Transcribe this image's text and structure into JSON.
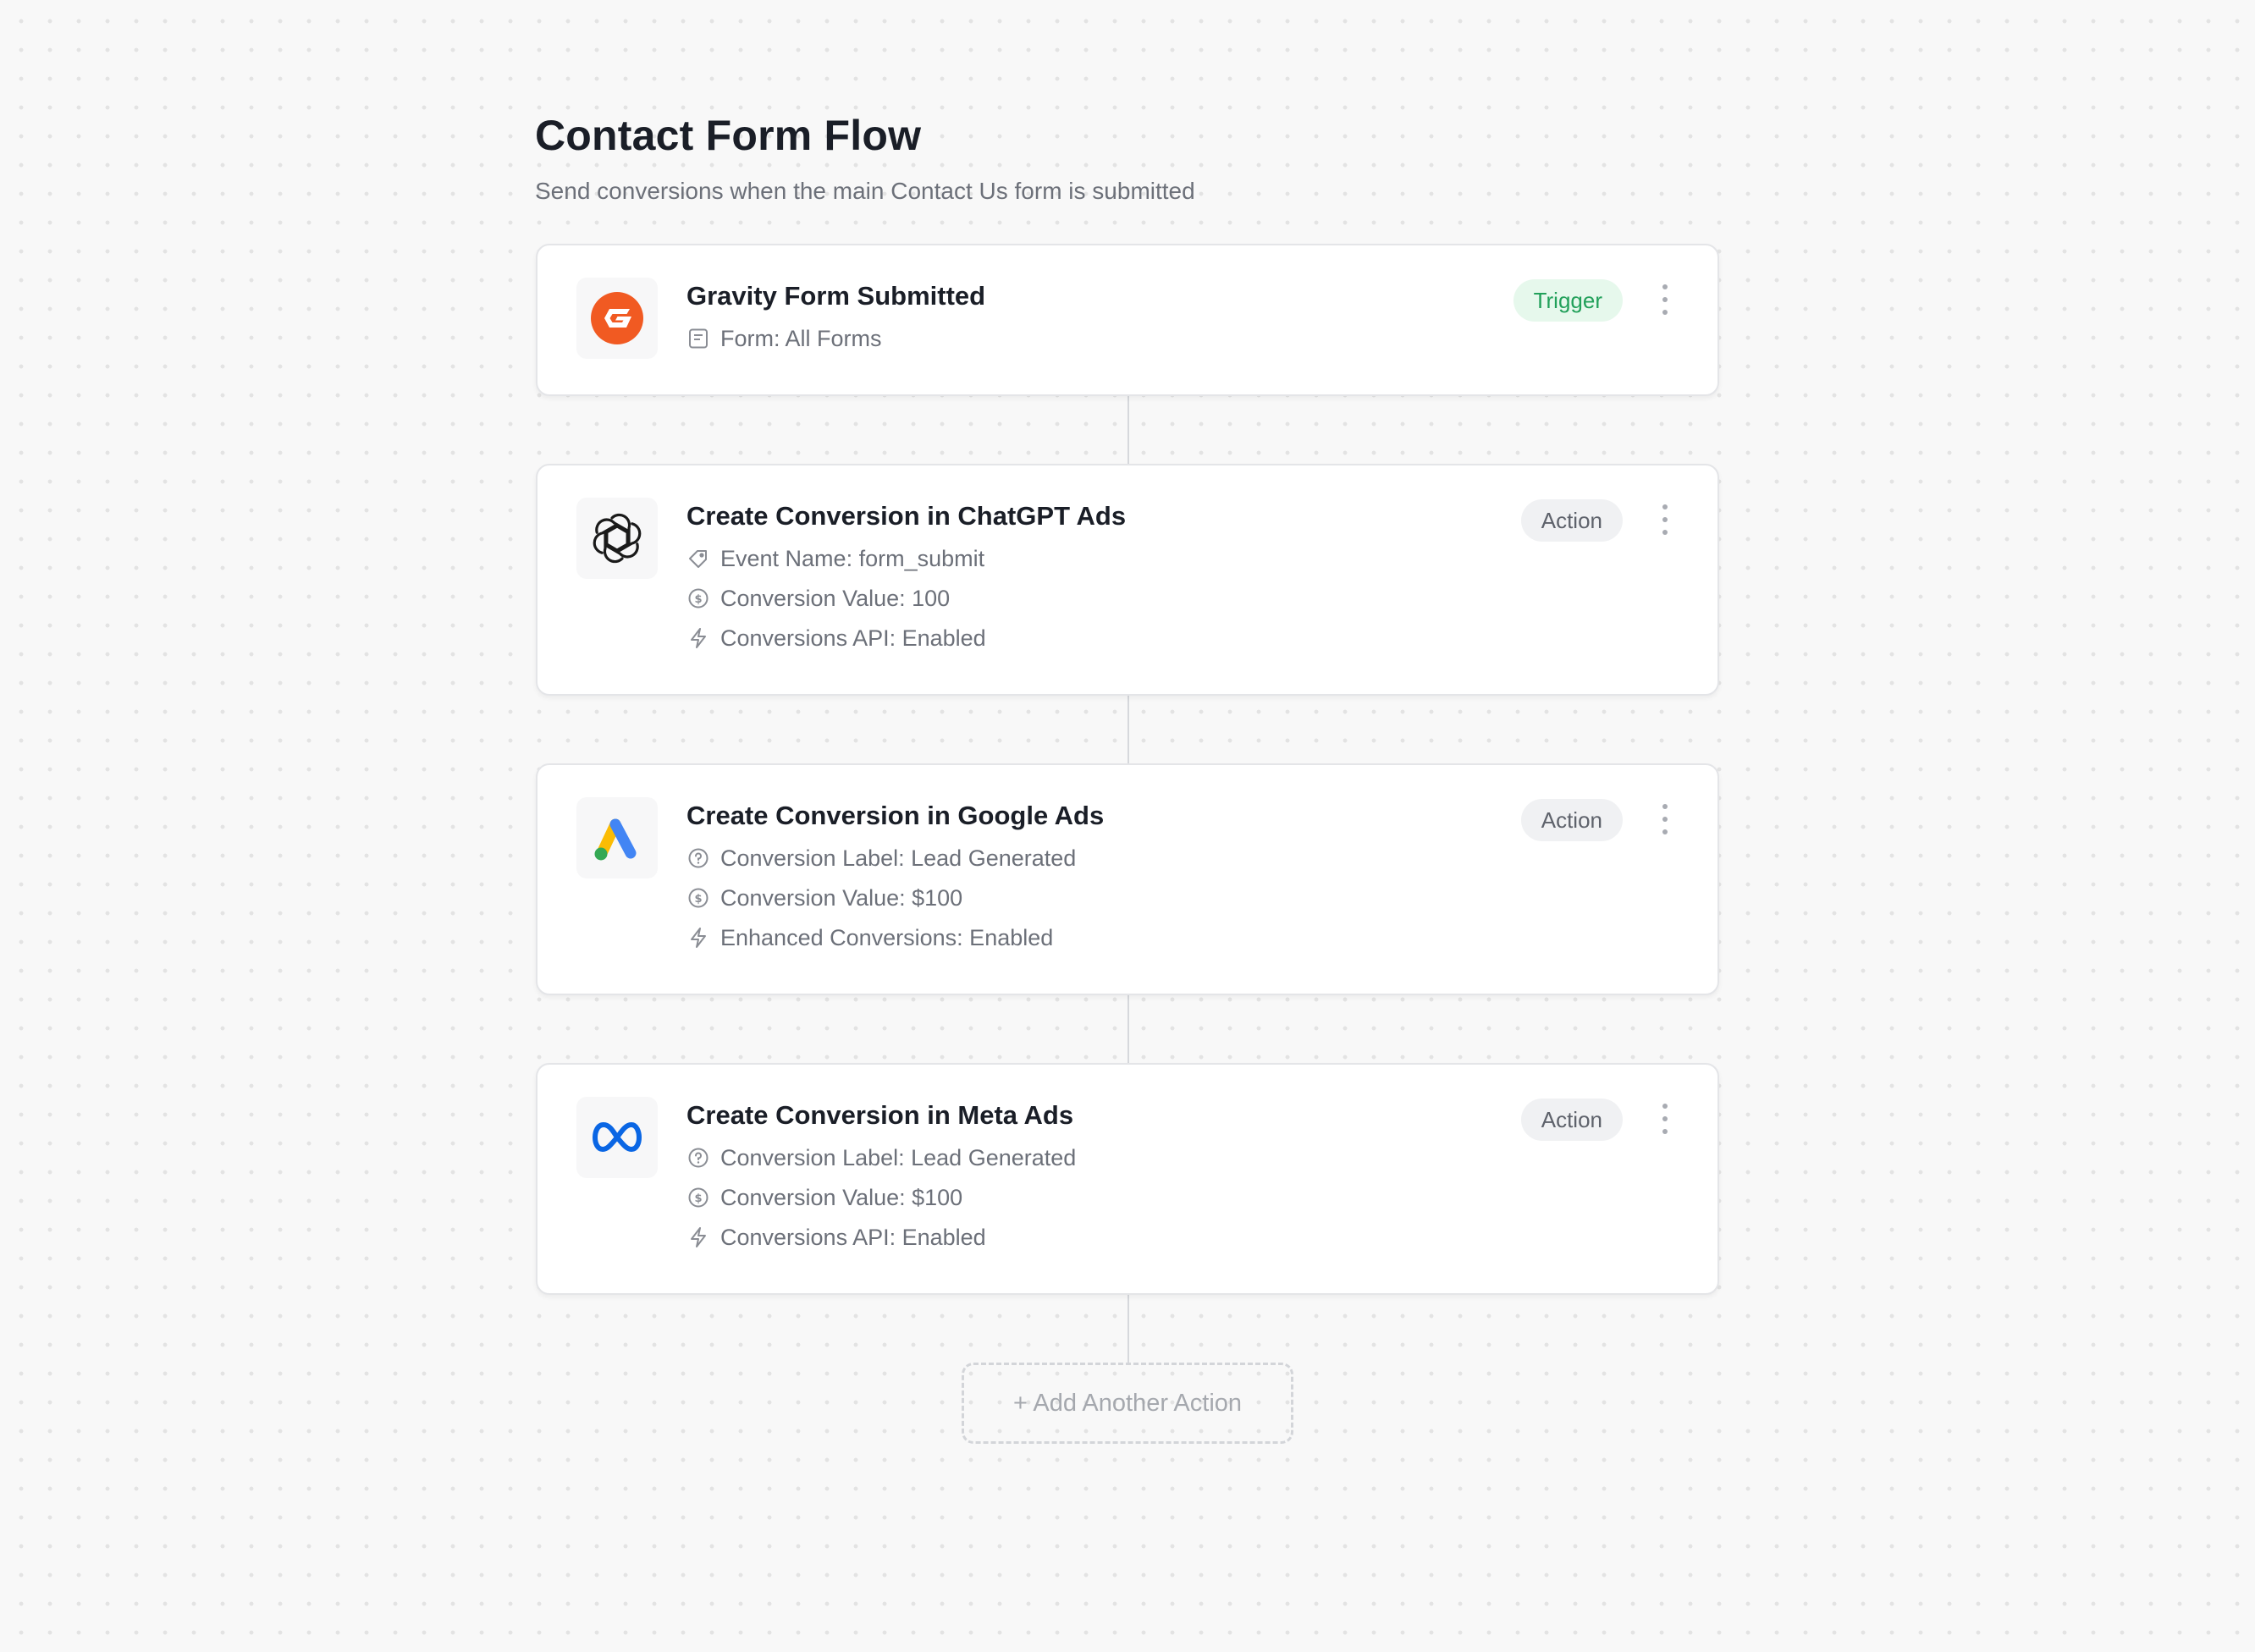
{
  "header": {
    "title": "Contact Form Flow",
    "subtitle": "Send conversions when the main Contact Us form is submitted"
  },
  "steps": [
    {
      "logo": "gravity-forms-logo",
      "title": "Gravity Form Submitted",
      "badge": "Trigger",
      "details": [
        {
          "icon": "form-icon",
          "text": "Form: All Forms"
        }
      ]
    },
    {
      "logo": "openai-logo",
      "title": "Create Conversion in ChatGPT Ads",
      "badge": "Action",
      "details": [
        {
          "icon": "tag-icon",
          "text": "Event Name: form_submit"
        },
        {
          "icon": "dollar-circle-icon",
          "text": "Conversion Value: 100"
        },
        {
          "icon": "lightning-icon",
          "text": "Conversions API: Enabled"
        }
      ]
    },
    {
      "logo": "google-ads-logo",
      "title": "Create Conversion in Google Ads",
      "badge": "Action",
      "details": [
        {
          "icon": "question-circle-icon",
          "text": "Conversion Label: Lead Generated"
        },
        {
          "icon": "dollar-circle-icon",
          "text": "Conversion Value: $100"
        },
        {
          "icon": "lightning-icon",
          "text": "Enhanced Conversions: Enabled"
        }
      ]
    },
    {
      "logo": "meta-logo",
      "title": "Create Conversion in Meta Ads",
      "badge": "Action",
      "details": [
        {
          "icon": "question-circle-icon",
          "text": "Conversion Label: Lead Generated"
        },
        {
          "icon": "dollar-circle-icon",
          "text": "Conversion Value: $100"
        },
        {
          "icon": "lightning-icon",
          "text": "Conversions API: Enabled"
        }
      ]
    }
  ],
  "add_button": {
    "label": "+ Add Another Action"
  },
  "colors": {
    "background": "#f8f8f8",
    "trigger_badge_bg": "#e6f8ec",
    "trigger_badge_text": "#22a05a",
    "action_badge_bg": "#f0f1f3",
    "gravity_orange": "#f15a22",
    "google_yellow": "#fbbc04",
    "google_blue": "#4285f4",
    "google_green": "#34a853",
    "meta_blue": "#0a66e4"
  }
}
